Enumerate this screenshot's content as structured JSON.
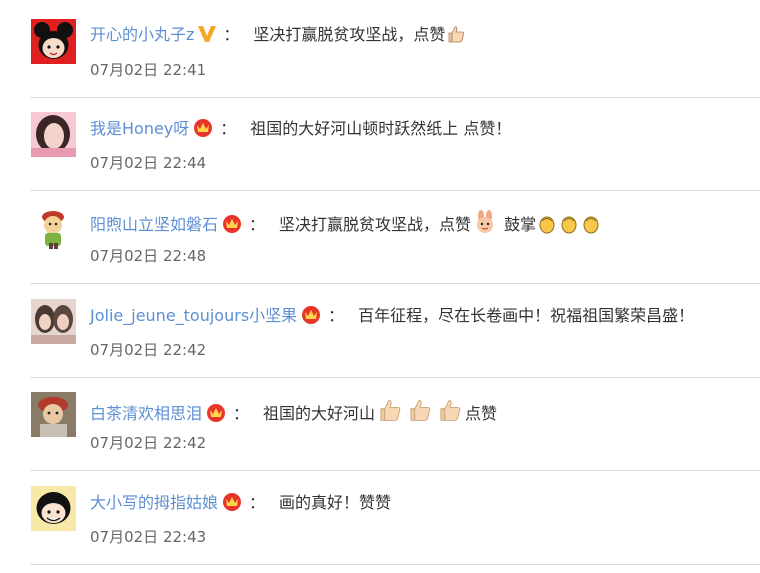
{
  "comments": [
    {
      "username": "开心的小丸子z",
      "badge": "vip-v-badge-icon",
      "colon": "：",
      "text": "坚决打赢脱贫攻坚战，点赞",
      "emojis_after": [
        "thumbs-up-icon"
      ],
      "time": "07月02日 22:41"
    },
    {
      "username": "我是Honey呀",
      "badge": "crown-fan-badge-icon",
      "colon": "：",
      "text": "祖国的大好河山顿时跃然纸上 点赞！",
      "emojis_after": [],
      "time": "07月02日 22:44"
    },
    {
      "username": "阳煦山立坚如磐石",
      "badge": "crown-fan-badge-icon",
      "colon": "：",
      "text": "坚决打赢脱贫攻坚战，点赞",
      "emojis_after": [
        "bunny-celebrate-icon"
      ],
      "text2": " 鼓掌",
      "emojis_after2": [
        "clap-icon",
        "clap-icon",
        "clap-icon"
      ],
      "time": "07月02日 22:48"
    },
    {
      "username": "Jolie_jeune_toujours小坚果",
      "badge": "crown-fan-badge-icon",
      "colon": "：",
      "text": "百年征程，尽在长卷画中！祝福祖国繁荣昌盛！",
      "emojis_after": [],
      "time": "07月02日 22:42"
    },
    {
      "username": "白茶清欢相思泪",
      "badge": "crown-fan-badge-icon",
      "colon": "：",
      "text": "祖国的大好河山",
      "emojis_after": [
        "thumbs-up-icon",
        "thumbs-up-icon",
        "thumbs-up-icon"
      ],
      "text2": "点赞",
      "time": "07月02日 22:42"
    },
    {
      "username": "大小写的拇指姑娘",
      "badge": "crown-fan-badge-icon",
      "colon": "：",
      "text": "画的真好！赞赞",
      "emojis_after": [],
      "time": "07月02日 22:43"
    }
  ],
  "colors": {
    "username": "#5d8fd3",
    "text": "#333333",
    "time": "#666666",
    "divider": "#dcdcdc",
    "vip_badge": "#f5a623",
    "crown_badge": "#e8352c"
  }
}
